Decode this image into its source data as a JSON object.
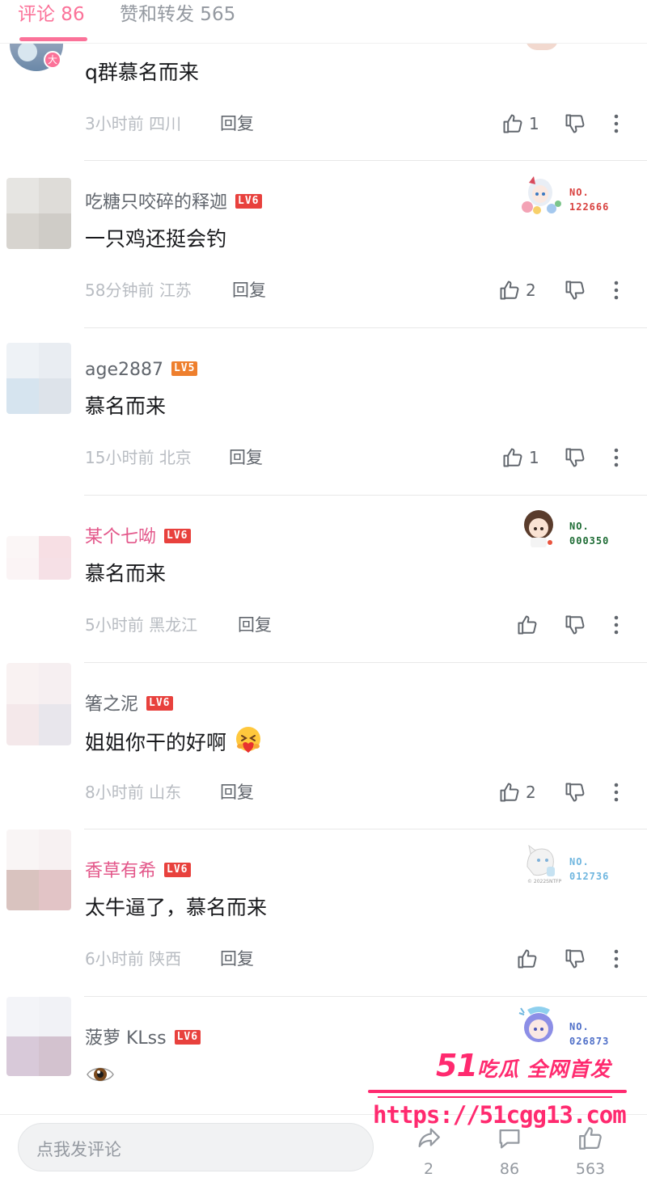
{
  "tabs": {
    "comments": "评论 86",
    "likes_reposts": "赞和转发 565"
  },
  "comments": [
    {
      "content": "q群慕名而来",
      "time": "3小时前",
      "location": "四川",
      "reply": "回复",
      "likes": "1"
    },
    {
      "username": "吃糖只咬碎的释迦",
      "level": "LV6",
      "badge_no_label": "NO.",
      "badge_no": "122666",
      "content": "一只鸡还挺会钓",
      "time": "58分钟前",
      "location": "江苏",
      "reply": "回复",
      "likes": "2"
    },
    {
      "username": "age2887",
      "level": "LV5",
      "content": "慕名而来",
      "time": "15小时前",
      "location": "北京",
      "reply": "回复",
      "likes": "1"
    },
    {
      "username": "某个七呦",
      "level": "LV6",
      "badge_no_label": "NO.",
      "badge_no": "000350",
      "content": "慕名而来",
      "time": "5小时前",
      "location": "黑龙江",
      "reply": "回复",
      "likes": ""
    },
    {
      "username": "箸之泥",
      "level": "LV6",
      "content": "姐姐你干的好啊",
      "time": "8小时前",
      "location": "山东",
      "reply": "回复",
      "likes": "2"
    },
    {
      "username": "香草有希",
      "level": "LV6",
      "badge_no_label": "NO.",
      "badge_no": "012736",
      "badge_caption": "© 2022SNTFP",
      "content": "太牛逼了，慕名而来",
      "time": "6小时前",
      "location": "陕西",
      "reply": "回复",
      "likes": ""
    },
    {
      "username": "菠萝 KLss",
      "level": "LV6",
      "badge_no_label": "NO.",
      "badge_no": "026873",
      "content": "",
      "content_icon": "eye-emoji"
    }
  ],
  "bottom_bar": {
    "input_placeholder": "点我发评论",
    "share_count": "2",
    "comment_count": "86",
    "like_count": "563"
  },
  "watermark": {
    "brand_number": "51",
    "brand_text": "吃瓜 全网首发",
    "url": "https://51cgg13.com"
  },
  "colors": {
    "accent_pink": "#fb7299",
    "vip_name": "#e3578a",
    "level_red": "#e8413d",
    "level_orange": "#ee7f2d",
    "watermark": "#ff2a6f"
  }
}
